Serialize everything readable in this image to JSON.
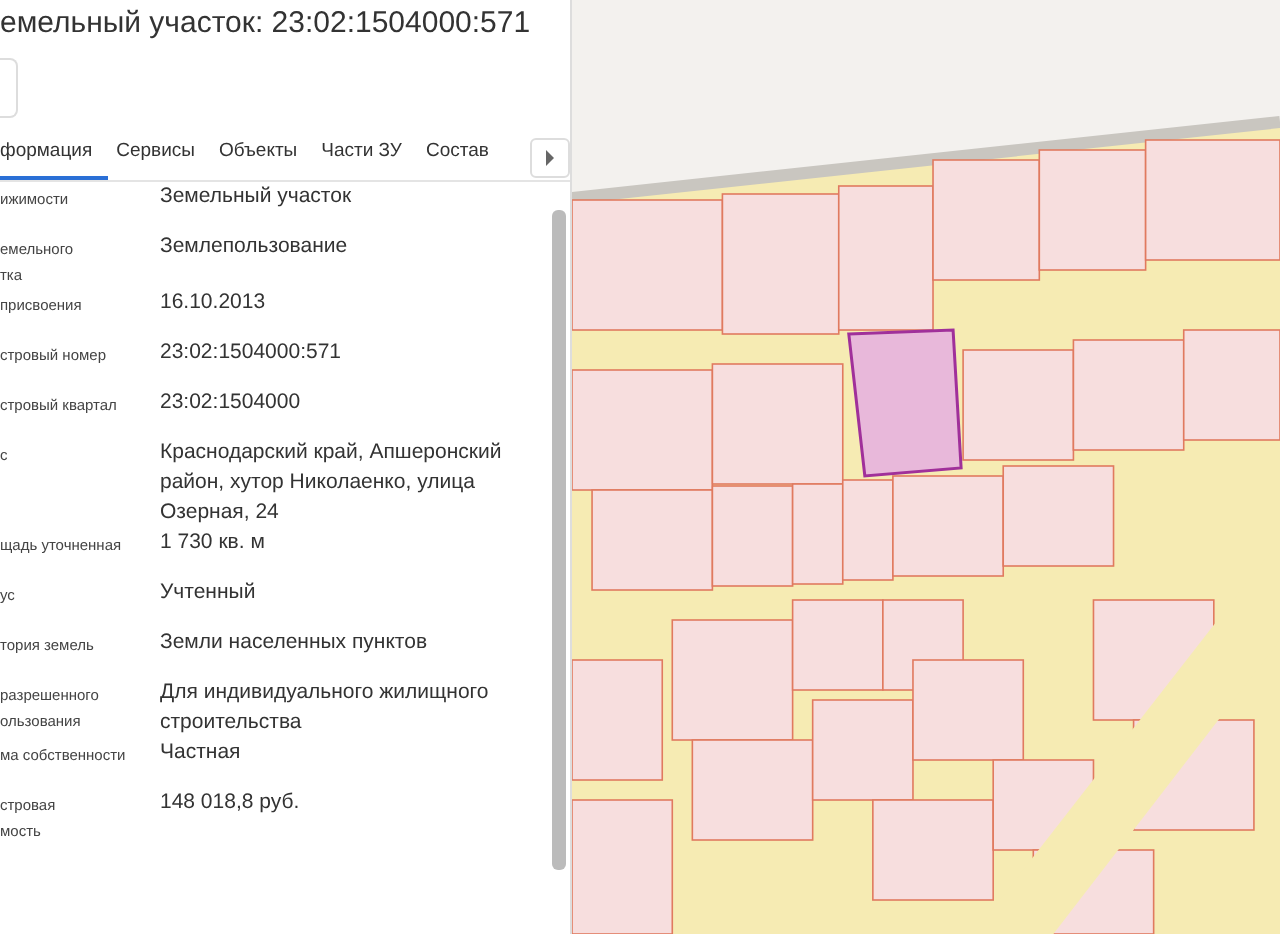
{
  "title": "емельный участок: 23:02:1504000:571",
  "tabs": [
    {
      "label": "формация",
      "selected": true
    },
    {
      "label": "Сервисы",
      "selected": false
    },
    {
      "label": "Объекты",
      "selected": false
    },
    {
      "label": "Части ЗУ",
      "selected": false
    },
    {
      "label": "Состав",
      "selected": false
    }
  ],
  "rows": [
    {
      "label": [
        "ижимости"
      ],
      "value": "Земельный участок"
    },
    {
      "label": [
        "емельного",
        "тка"
      ],
      "value": "Землепользование"
    },
    {
      "label": [
        "присвоения"
      ],
      "value": "16.10.2013"
    },
    {
      "label": [
        "стровый номер"
      ],
      "value": "23:02:1504000:571"
    },
    {
      "label": [
        "стровый квартал"
      ],
      "value": "23:02:1504000"
    },
    {
      "label": [
        "с"
      ],
      "value": "Краснодарский край, Апшеронский район, хутор Николаенко, улица Озерная, 24"
    },
    {
      "label": [
        "щадь уточненная"
      ],
      "value": "1 730 кв. м"
    },
    {
      "label": [
        "ус"
      ],
      "value": "Учтенный"
    },
    {
      "label": [
        "тория земель"
      ],
      "value": "Земли населенных пунктов"
    },
    {
      "label": [
        "разрешенного",
        "ользования"
      ],
      "value": "Для индивидуального жилищного строительства"
    },
    {
      "label": [
        "ма собственности"
      ],
      "value": "Частная"
    },
    {
      "label": [
        "стровая",
        "мость"
      ],
      "value": "148 018,8 руб."
    }
  ]
}
